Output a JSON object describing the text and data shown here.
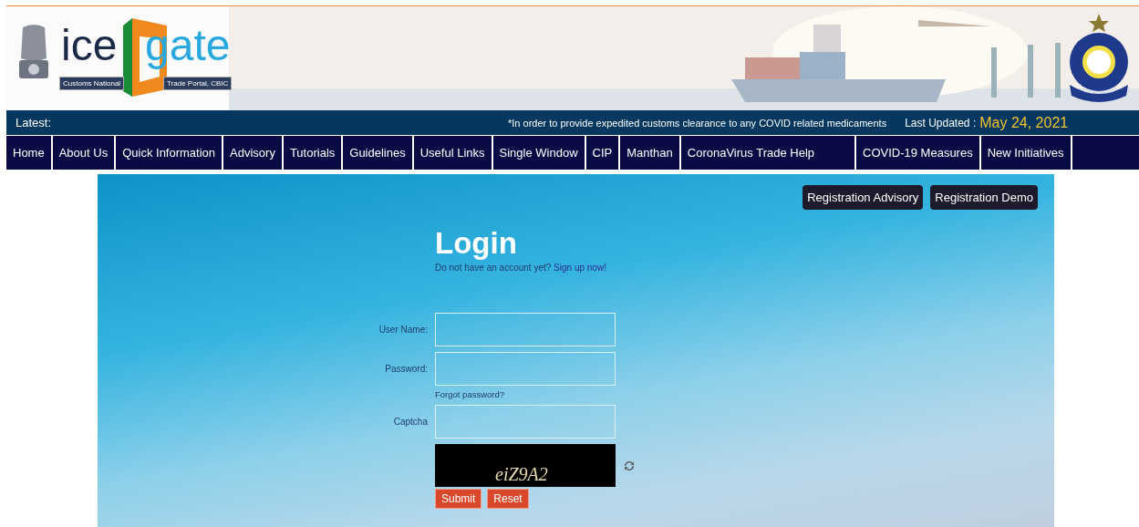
{
  "logo": {
    "word_left": "ice",
    "word_right": "gate",
    "caption_left": "Customs National",
    "caption_right": "Trade Portal, CBIC"
  },
  "latest": {
    "label": "Latest:",
    "message": "*In order to provide expedited customs clearance to any COVID related medicaments",
    "updated_label": "Last Updated :",
    "updated_date": "May 24, 2021"
  },
  "nav": [
    "Home",
    "About Us",
    "Quick Information",
    "Advisory",
    "Tutorials",
    "Guidelines",
    "Useful Links",
    "Single Window",
    "CIP",
    "Manthan",
    "CoronaVirus Trade Help",
    "COVID-19 Measures",
    "New Initiatives"
  ],
  "top_buttons": [
    "Registration Advisory",
    "Registration Demo"
  ],
  "login": {
    "title": "Login",
    "signup_prompt": "Do not have an account yet?",
    "signup_link": "Sign up now!",
    "fields": [
      {
        "label": "User Name:"
      },
      {
        "label": "Password:"
      }
    ],
    "forgot_link": "Forgot password?",
    "captcha_label": "Captcha",
    "captcha_text": "eiZ9A2",
    "buttons": [
      "Submit",
      "Reset"
    ]
  }
}
